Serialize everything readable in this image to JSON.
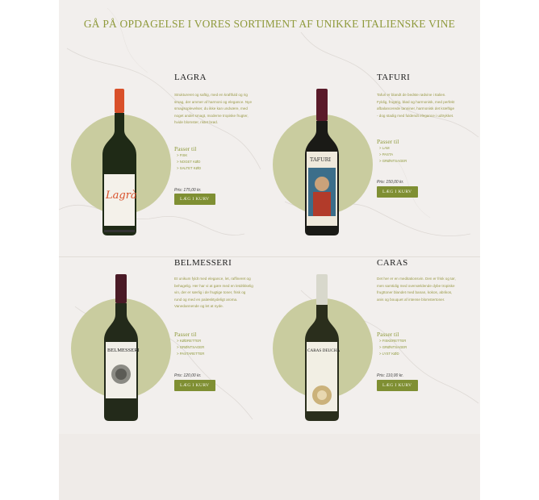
{
  "headline": "GÅ PÅ OPDAGELSE I VORES SORTIMENT AF UNIKKE ITALIENSKE VINE",
  "colors": {
    "accent": "#8f9a3c",
    "button": "#7f8f33",
    "circle": "#c9cc9f",
    "background": "#f2efed"
  },
  "products": [
    {
      "name": "LAGRA",
      "description": "Struktureret og saftig, med en kraftfuld og rig smag, der ammer af harmoni og elegance. Nye smagsoplevelser, du ikke kan undvære, med noget andet smagt, moderne tropiske frugter, hvide blomster, ristet brød.",
      "pairs_title": "Passer til",
      "pairs": [
        "FISK",
        "NOGET KØD",
        "SALTET KØD"
      ],
      "price": "Pris: 175,00 kr.",
      "button": "LÆG I KURV",
      "label_text": "Lagrà",
      "bottle_color": "#1f2a16",
      "capsule_color": "#d9502a"
    },
    {
      "name": "TAFURI",
      "description": "Tafuri er blandt de bedste rødvine i Italien. Fyldig, frugtrig, blød og harmonisk, med perfekt afbalancerede tanniner, harmonisk det kræftige - dog stadig med fuldendt elegance i udtrykket.",
      "pairs_title": "Passer til",
      "pairs": [
        "LAM",
        "PASTA",
        "GRØNTSAGER"
      ],
      "price": "Pris: 150,00 kr.",
      "button": "LÆG I KURV",
      "label_text": "TAFURI",
      "bottle_color": "#1a1a16",
      "capsule_color": "#5a1a2a"
    },
    {
      "name": "BELMESSERI",
      "description": "Et unikum fyldt med elegance, let, raffineret og behagelig. Her har vi at gøre med en letdrikkelig vin, der er særlig i de frugtige toner, frisk og rund og med en palæsktydeligt aroma. Vanedannende og let at nyde.",
      "pairs_title": "Passer til",
      "pairs": [
        "KØDRETTER",
        "GRØNTSAGER",
        "PASTARETTER"
      ],
      "price": "Pris: 120,00 kr.",
      "button": "LÆG I KURV",
      "label_text": "BELMESSERI",
      "bottle_color": "#232a1a",
      "capsule_color": "#4a1a26"
    },
    {
      "name": "CARAS",
      "description": "Det her er en meditationsvin. Den er frisk og tør, men samtidig med overvældende dybe tropiske frugttoner blandet med banan, kokos, abrikos, anis og bouquet af intense blomstertoner.",
      "pairs_title": "Passer til",
      "pairs": [
        "FISKERETTER",
        "GRØNTSAGER",
        "LYST KØD"
      ],
      "price": "Pris: 110,00 kr.",
      "button": "LÆG I KURV",
      "label_text": "CARAS DEUCHA",
      "bottle_color": "#2a2e1c",
      "capsule_color": "#d8d8cc"
    }
  ]
}
